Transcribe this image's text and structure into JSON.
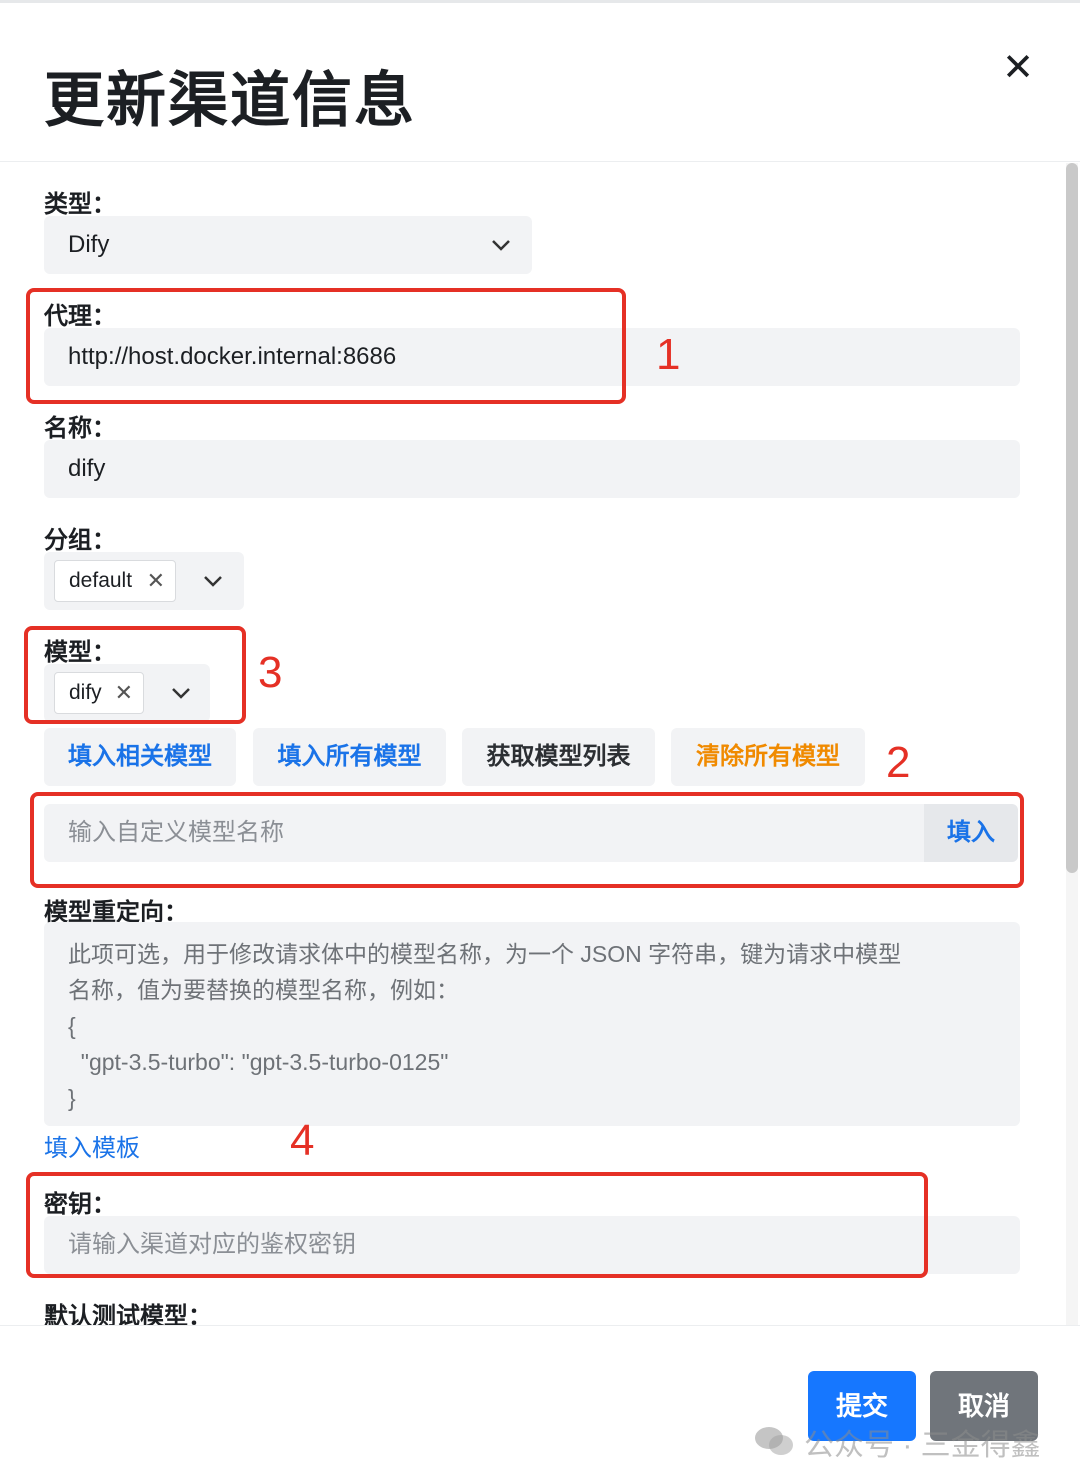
{
  "dialog": {
    "title": "更新渠道信息",
    "close_icon": "close-icon"
  },
  "form": {
    "type": {
      "label": "类型：",
      "value": "Dify"
    },
    "proxy": {
      "label": "代理：",
      "value": "http://host.docker.internal:8686"
    },
    "name": {
      "label": "名称：",
      "value": "dify"
    },
    "group": {
      "label": "分组：",
      "tags": [
        "default"
      ]
    },
    "models": {
      "label": "模型：",
      "tags": [
        "dify"
      ]
    },
    "model_buttons": {
      "fill_related": "填入相关模型",
      "fill_all": "填入所有模型",
      "fetch_list": "获取模型列表",
      "clear_all": "清除所有模型"
    },
    "custom_model": {
      "placeholder": "输入自定义模型名称",
      "button": "填入"
    },
    "model_mapping": {
      "label": "模型重定向：",
      "placeholder_lines": [
        "此项可选，用于修改请求体中的模型名称，为一个 JSON 字符串，键为请求中模型",
        "名称，值为要替换的模型名称，例如：",
        "{",
        "  \"gpt-3.5-turbo\": \"gpt-3.5-turbo-0125\"",
        "}"
      ],
      "template_link": "填入模板"
    },
    "key": {
      "label": "密钥：",
      "placeholder": "请输入渠道对应的鉴权密钥"
    },
    "default_test_model": {
      "label": "默认测试模型："
    }
  },
  "footer": {
    "submit": "提交",
    "cancel": "取消"
  },
  "annotations": {
    "a1": "1",
    "a2": "2",
    "a3": "3",
    "a4": "4"
  },
  "watermark": "公众号 · 三金得鑫",
  "colors": {
    "annotation_red": "#e53025",
    "link_blue": "#1a73e8",
    "primary": "#1677ff",
    "warning": "#f08a00"
  }
}
